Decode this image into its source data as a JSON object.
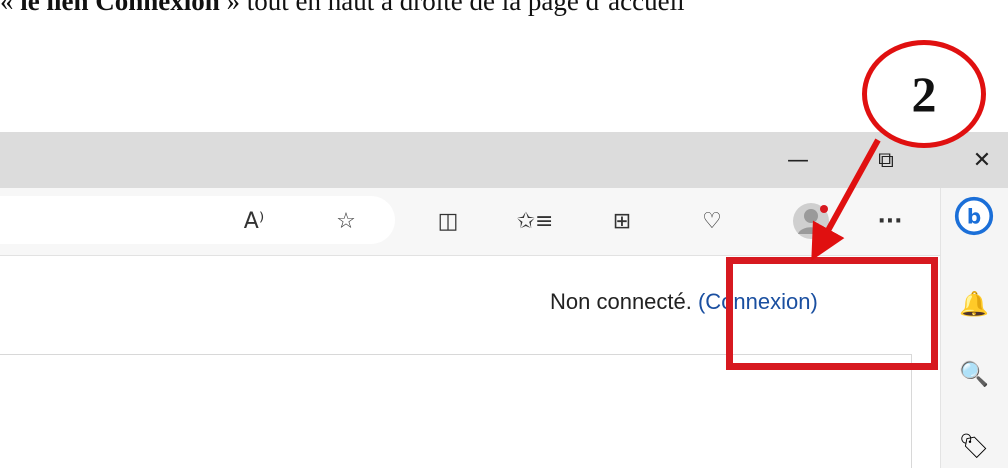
{
  "caption": {
    "quote_open": "« ",
    "bold": "le lien Connexion",
    "rest": " » tout en haut à droite de la page d’accueil"
  },
  "window_controls": {
    "minimize": "—",
    "restore": "⧉",
    "close": "✕"
  },
  "toolbar": {
    "read_aloud": "A⁾",
    "favorite": "☆",
    "split_screen": "◫",
    "favorites_list": "✩≡",
    "collections": "⊞",
    "health": "♡",
    "more": "···"
  },
  "sidebar": {
    "bing": "b",
    "notifications": "🔔",
    "search": "🔍",
    "shopping": "🏷"
  },
  "page": {
    "status_text": "Non connecté. ",
    "login_link": "(Connexion)"
  },
  "annotation": {
    "step_number": "2",
    "accent_color": "#d71920"
  }
}
